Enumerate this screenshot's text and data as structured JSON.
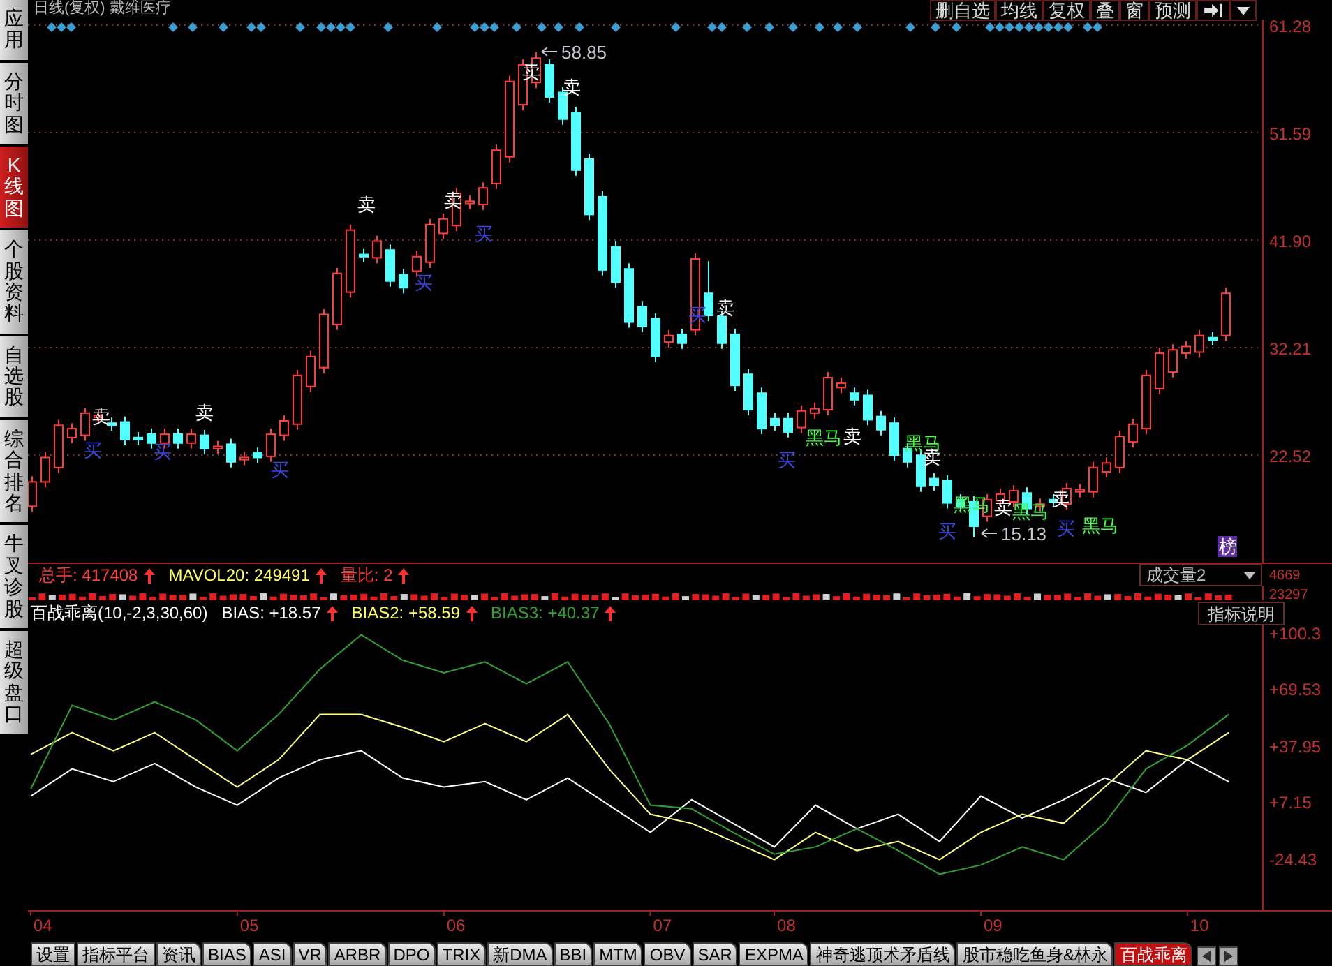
{
  "sidebar": {
    "tabs": [
      {
        "label": "应用",
        "selected": false
      },
      {
        "label": "分时图",
        "selected": false
      },
      {
        "label": "K线图",
        "selected": true
      },
      {
        "label": "个股资料",
        "selected": false
      },
      {
        "label": "自选股",
        "selected": false
      },
      {
        "label": "综合排名",
        "selected": false
      },
      {
        "label": "牛叉诊股",
        "selected": false
      },
      {
        "label": "超级盘口",
        "selected": false
      }
    ]
  },
  "header": {
    "title": "日线(复权) 戴维医疗"
  },
  "toolbar": {
    "buttons": [
      "删自选",
      "均线",
      "复权",
      "叠",
      "窗",
      "预测"
    ]
  },
  "price_chart": {
    "markers": [
      {
        "text": "卖",
        "kind": "sell"
      },
      {
        "text": "买",
        "kind": "buy"
      },
      {
        "text": "买",
        "kind": "buy"
      },
      {
        "text": "卖",
        "kind": "sell"
      },
      {
        "text": "买",
        "kind": "buy"
      },
      {
        "text": "卖",
        "kind": "sell"
      },
      {
        "text": "买",
        "kind": "buy"
      },
      {
        "text": "卖",
        "kind": "sell"
      },
      {
        "text": "买",
        "kind": "buy"
      },
      {
        "text": "卖",
        "kind": "sell"
      },
      {
        "text": "58.85",
        "kind": "price"
      },
      {
        "text": "卖",
        "kind": "sell"
      },
      {
        "text": "买",
        "kind": "buy"
      },
      {
        "text": "卖",
        "kind": "sell"
      },
      {
        "text": "买",
        "kind": "buy"
      },
      {
        "text": "黑马",
        "kind": "horse"
      },
      {
        "text": "卖",
        "kind": "sell"
      },
      {
        "text": "黑马",
        "kind": "horse"
      },
      {
        "text": "卖",
        "kind": "sell"
      },
      {
        "text": "黑马",
        "kind": "horse"
      },
      {
        "text": "卖",
        "kind": "sell"
      },
      {
        "text": "买",
        "kind": "buy"
      },
      {
        "text": "黑马",
        "kind": "horse"
      },
      {
        "text": "卖",
        "kind": "sell"
      },
      {
        "text": "15.13",
        "kind": "price"
      },
      {
        "text": "买",
        "kind": "buy"
      },
      {
        "text": "黑马",
        "kind": "horse"
      },
      {
        "text": "榜",
        "kind": "badge"
      }
    ],
    "chart_data": {
      "type": "candlestick",
      "grid": true,
      "categories": [
        null,
        null,
        null,
        null,
        null,
        null,
        null,
        null,
        null,
        null,
        null,
        null,
        null,
        null,
        null,
        null,
        null,
        null,
        null,
        null,
        null,
        null,
        null,
        null,
        null,
        null,
        null,
        null,
        null,
        null,
        null,
        null,
        null,
        null,
        null,
        null,
        null,
        null,
        null,
        null,
        null,
        null,
        null,
        null,
        null,
        null,
        null,
        null,
        null,
        null,
        null,
        null,
        null,
        null,
        null,
        null,
        null,
        null,
        null,
        null,
        null,
        null,
        null,
        null,
        null,
        null,
        null,
        null,
        null,
        null,
        null,
        null,
        null,
        null,
        null,
        null,
        null,
        null,
        null,
        null,
        null,
        null,
        null,
        null,
        null,
        null,
        null,
        null,
        null,
        null,
        null
      ],
      "ohlc": [
        [
          17.9,
          20.6,
          17.4,
          20.1
        ],
        [
          20.1,
          22.8,
          19.6,
          22.3
        ],
        [
          21.4,
          25.7,
          20.9,
          25.2
        ],
        [
          24.1,
          25.4,
          23.6,
          24.9
        ],
        [
          24.3,
          26.8,
          23.8,
          26.3
        ],
        [
          25.9,
          26.6,
          25.4,
          26.1
        ],
        [
          25.4,
          25.9,
          24.7,
          25.2
        ],
        [
          25.5,
          26,
          23.4,
          23.9
        ],
        [
          24.1,
          24.6,
          23.4,
          23.9
        ],
        [
          24.4,
          24.9,
          23.1,
          23.6
        ],
        [
          23.6,
          24.9,
          23.1,
          24.4
        ],
        [
          24.4,
          24.9,
          23.1,
          23.6
        ],
        [
          23.6,
          24.9,
          23.1,
          24.4
        ],
        [
          24.3,
          24.8,
          22.6,
          23.1
        ],
        [
          23.1,
          23.8,
          22.6,
          23.3
        ],
        [
          23.5,
          24,
          21.4,
          21.9
        ],
        [
          22.1,
          22.8,
          21.6,
          22.3
        ],
        [
          22.7,
          23.2,
          21.8,
          22.3
        ],
        [
          22.4,
          24.9,
          21.9,
          24.4
        ],
        [
          24.3,
          26.1,
          23.8,
          25.6
        ],
        [
          25.3,
          30.2,
          24.8,
          29.7
        ],
        [
          28.7,
          31.9,
          28.2,
          31.4
        ],
        [
          30.4,
          35.7,
          29.9,
          35.2
        ],
        [
          34.3,
          39.4,
          33.8,
          38.9
        ],
        [
          37.2,
          43.3,
          36.7,
          42.8
        ],
        [
          40.6,
          41.1,
          39.9,
          40.4
        ],
        [
          40.3,
          42.3,
          39.8,
          41.8
        ],
        [
          41,
          41.5,
          37.7,
          38.2
        ],
        [
          38.8,
          39.3,
          37.1,
          37.6
        ],
        [
          39.1,
          40.9,
          38.6,
          40.4
        ],
        [
          39.9,
          43.8,
          39.4,
          43.3
        ],
        [
          42.5,
          44.3,
          42,
          43.8
        ],
        [
          43.2,
          46.6,
          42.7,
          46.1
        ],
        [
          45.2,
          45.9,
          44.7,
          45.4
        ],
        [
          45.1,
          47.1,
          44.6,
          46.6
        ],
        [
          47,
          50.5,
          46.5,
          50
        ],
        [
          49.4,
          56.7,
          48.9,
          56.2
        ],
        [
          54.1,
          58.2,
          53.6,
          57.7
        ],
        [
          56.1,
          58.85,
          55.6,
          58.3
        ],
        [
          57.7,
          58.2,
          54.3,
          54.8
        ],
        [
          55.2,
          55.7,
          52.3,
          52.8
        ],
        [
          53.4,
          53.9,
          47.7,
          48.2
        ],
        [
          49.2,
          49.7,
          43.7,
          44.2
        ],
        [
          45.8,
          46.3,
          38.7,
          39.2
        ],
        [
          41.3,
          41.8,
          37.6,
          38.1
        ],
        [
          39.3,
          39.8,
          34,
          34.5
        ],
        [
          35.9,
          36.4,
          33.6,
          34.1
        ],
        [
          34.8,
          35.3,
          30.9,
          31.4
        ],
        [
          32.7,
          33.8,
          32.2,
          33.3
        ],
        [
          33.4,
          33.9,
          32.1,
          32.6
        ],
        [
          33.8,
          40.7,
          33.3,
          40.2
        ],
        [
          37.1,
          40,
          34.6,
          35.1
        ],
        [
          35,
          35.5,
          32.1,
          32.6
        ],
        [
          33.4,
          33.9,
          28.3,
          28.8
        ],
        [
          29.8,
          30.3,
          26.1,
          26.6
        ],
        [
          28.1,
          28.6,
          24.4,
          24.9
        ],
        [
          25.8,
          26.3,
          24.7,
          25.2
        ],
        [
          25.8,
          26.3,
          24.1,
          24.6
        ],
        [
          25,
          27,
          24.5,
          26.5
        ],
        [
          26.3,
          27.2,
          25.8,
          26.7
        ],
        [
          26.6,
          30,
          26.1,
          29.5
        ],
        [
          28.6,
          29.5,
          28.1,
          29
        ],
        [
          28.1,
          28.6,
          27,
          27.5
        ],
        [
          27.9,
          28.4,
          25.2,
          25.7
        ],
        [
          26,
          26.5,
          24.3,
          24.8
        ],
        [
          25.4,
          25.9,
          22,
          22.5
        ],
        [
          23.1,
          23.6,
          21.4,
          21.9
        ],
        [
          22.5,
          23,
          19.2,
          19.7
        ],
        [
          20.4,
          20.9,
          19.3,
          19.8
        ],
        [
          20.2,
          20.7,
          17.7,
          18.2
        ],
        [
          18.5,
          19,
          17.4,
          17.9
        ],
        [
          18.3,
          18.8,
          15.13,
          16.1
        ],
        [
          17,
          19,
          16.5,
          18.5
        ],
        [
          18.4,
          19.5,
          17.9,
          19
        ],
        [
          18.3,
          19.8,
          17.8,
          19.3
        ],
        [
          19.1,
          19.6,
          17.2,
          17.7
        ],
        [
          17.9,
          18.6,
          17.4,
          18.1
        ],
        [
          18.5,
          19,
          17.8,
          18.3
        ],
        [
          18.1,
          20,
          17.6,
          19.5
        ],
        [
          19.2,
          19.9,
          18.7,
          19.4
        ],
        [
          19.2,
          21.9,
          18.7,
          21.4
        ],
        [
          21,
          22.3,
          20.5,
          21.8
        ],
        [
          21.4,
          24.7,
          20.9,
          24.2
        ],
        [
          23.7,
          25.8,
          23.2,
          25.3
        ],
        [
          24.9,
          30.2,
          24.4,
          29.7
        ],
        [
          28.5,
          32.2,
          28,
          31.7
        ],
        [
          30,
          32.5,
          29.5,
          32
        ],
        [
          31.7,
          32.8,
          31.2,
          32.3
        ],
        [
          31.8,
          33.8,
          31.3,
          33.3
        ],
        [
          33.1,
          33.6,
          32.4,
          32.9
        ],
        [
          33.3,
          37.6,
          32.8,
          37.1
        ]
      ],
      "ylim": [
        12.7,
        61.78
      ],
      "yticks": [
        {
          "value": 61.28,
          "label": "61.28"
        },
        {
          "value": 51.59,
          "label": "51.59"
        },
        {
          "value": 41.9,
          "label": "41.90"
        },
        {
          "value": 32.21,
          "label": "32.21"
        },
        {
          "value": 22.52,
          "label": "22.52"
        }
      ]
    }
  },
  "volume": {
    "readouts": [
      {
        "text": "总手: 417408",
        "color": "#ff4040"
      },
      {
        "text": "MAVOL20: 249491",
        "color": "#ffff60"
      },
      {
        "text": "量比: 2",
        "color": "#ff4040"
      }
    ],
    "selector": "成交量2",
    "axis_labels": [
      "4669",
      "23297"
    ]
  },
  "indicator": {
    "title": "百战乖离(10,-2,3,30,60)",
    "readouts": [
      {
        "text": "BIAS: +18.57",
        "color": "#ffffff"
      },
      {
        "text": "BIAS2: +58.59",
        "color": "#ffff60"
      },
      {
        "text": "BIAS3: +40.37",
        "color": "#30a030"
      }
    ],
    "help_button": "指标说明",
    "chart_data": {
      "type": "line",
      "categories": [
        "04",
        null,
        null,
        null,
        null,
        "05",
        null,
        null,
        null,
        null,
        "06",
        null,
        null,
        null,
        null,
        "07",
        null,
        null,
        "08",
        null,
        null,
        null,
        null,
        "09",
        null,
        null,
        null,
        null,
        "10",
        null
      ],
      "series": [
        {
          "color": "#ffffff",
          "values": [
            10,
            25,
            18,
            28,
            15,
            5,
            20,
            30,
            35,
            20,
            15,
            18,
            8,
            20,
            5,
            -10,
            8,
            -5,
            -18,
            5,
            -8,
            0,
            -15,
            10,
            -2,
            8,
            20,
            12,
            30,
            18
          ]
        },
        {
          "color": "#ffff80",
          "values": [
            33,
            45,
            35,
            45,
            30,
            15,
            30,
            55,
            55,
            48,
            40,
            50,
            40,
            55,
            25,
            0,
            -5,
            -15,
            -25,
            -10,
            -20,
            -15,
            -25,
            -10,
            0,
            -5,
            15,
            35,
            30,
            45
          ]
        },
        {
          "color": "#30a030",
          "values": [
            14,
            60,
            52,
            62,
            52,
            35,
            55,
            80,
            99,
            85,
            78,
            84,
            72,
            84,
            50,
            5,
            3,
            -10,
            -22,
            -18,
            -8,
            -20,
            -33,
            -28,
            -18,
            -25,
            -5,
            25,
            38,
            55
          ]
        }
      ],
      "ylim": [
        -52.9,
        104.15
      ],
      "yticks": [
        {
          "value": 100.3,
          "label": "+100.3"
        },
        {
          "value": 69.53,
          "label": "+69.53"
        },
        {
          "value": 37.95,
          "label": "+37.95"
        },
        {
          "value": 7.15,
          "label": "+7.15"
        },
        {
          "value": -24.43,
          "label": "-24.43"
        }
      ]
    }
  },
  "bottom_tabs": [
    {
      "label": "设置",
      "kind": "button",
      "selected": false
    },
    {
      "label": "指标平台",
      "kind": "button",
      "selected": false
    },
    {
      "label": "资讯",
      "kind": "tab",
      "selected": false
    },
    {
      "label": "BIAS",
      "kind": "tab",
      "selected": false
    },
    {
      "label": "ASI",
      "kind": "tab",
      "selected": false
    },
    {
      "label": "VR",
      "kind": "tab",
      "selected": false
    },
    {
      "label": "ARBR",
      "kind": "tab",
      "selected": false
    },
    {
      "label": "DPO",
      "kind": "tab",
      "selected": false
    },
    {
      "label": "TRIX",
      "kind": "tab",
      "selected": false
    },
    {
      "label": "新DMA",
      "kind": "tab",
      "selected": false
    },
    {
      "label": "BBI",
      "kind": "tab",
      "selected": false
    },
    {
      "label": "MTM",
      "kind": "tab",
      "selected": false
    },
    {
      "label": "OBV",
      "kind": "tab",
      "selected": false
    },
    {
      "label": "SAR",
      "kind": "tab",
      "selected": false
    },
    {
      "label": "EXPMA",
      "kind": "tab",
      "selected": false
    },
    {
      "label": "神奇逃顶术矛盾线",
      "kind": "tab",
      "selected": false
    },
    {
      "label": "股市稳吃鱼身&林永",
      "kind": "tab",
      "selected": false
    },
    {
      "label": "百战乖离",
      "kind": "tab",
      "selected": true
    }
  ]
}
